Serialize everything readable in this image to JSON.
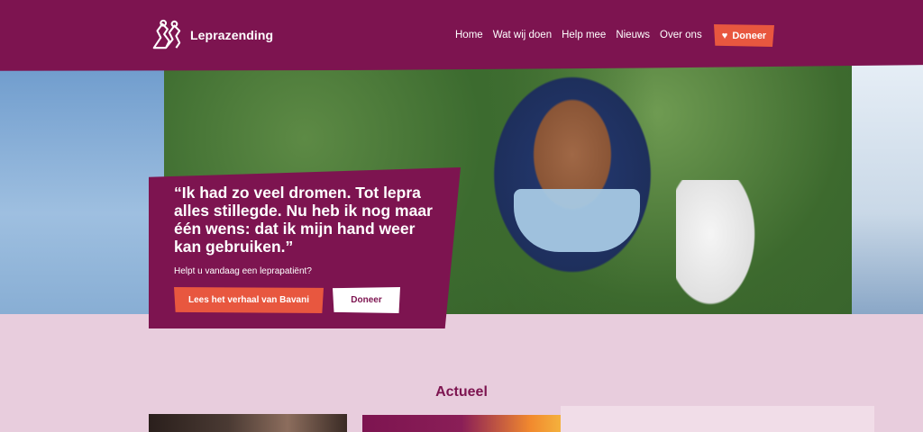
{
  "brand": {
    "name": "Leprazending"
  },
  "nav": {
    "items": [
      "Home",
      "Wat wij doen",
      "Help mee",
      "Nieuws",
      "Over ons"
    ]
  },
  "header": {
    "donate_label": "Doneer"
  },
  "hero": {
    "quote": "“Ik had zo veel dromen. Tot lepra alles stillegde. Nu heb ik nog maar één wens: dat ik mijn hand weer kan gebruiken.”",
    "subtext": "Helpt u vandaag een leprapatiënt?",
    "story_button": "Lees het verhaal van Bavani",
    "donate_button": "Doneer"
  },
  "news": {
    "title": "Actueel"
  },
  "colors": {
    "brand": "#7d1450",
    "accent": "#e8573f",
    "background": "#e8cddd"
  },
  "icons": {
    "logo": "leprazending-logo-icon",
    "heart": "heart-icon"
  }
}
